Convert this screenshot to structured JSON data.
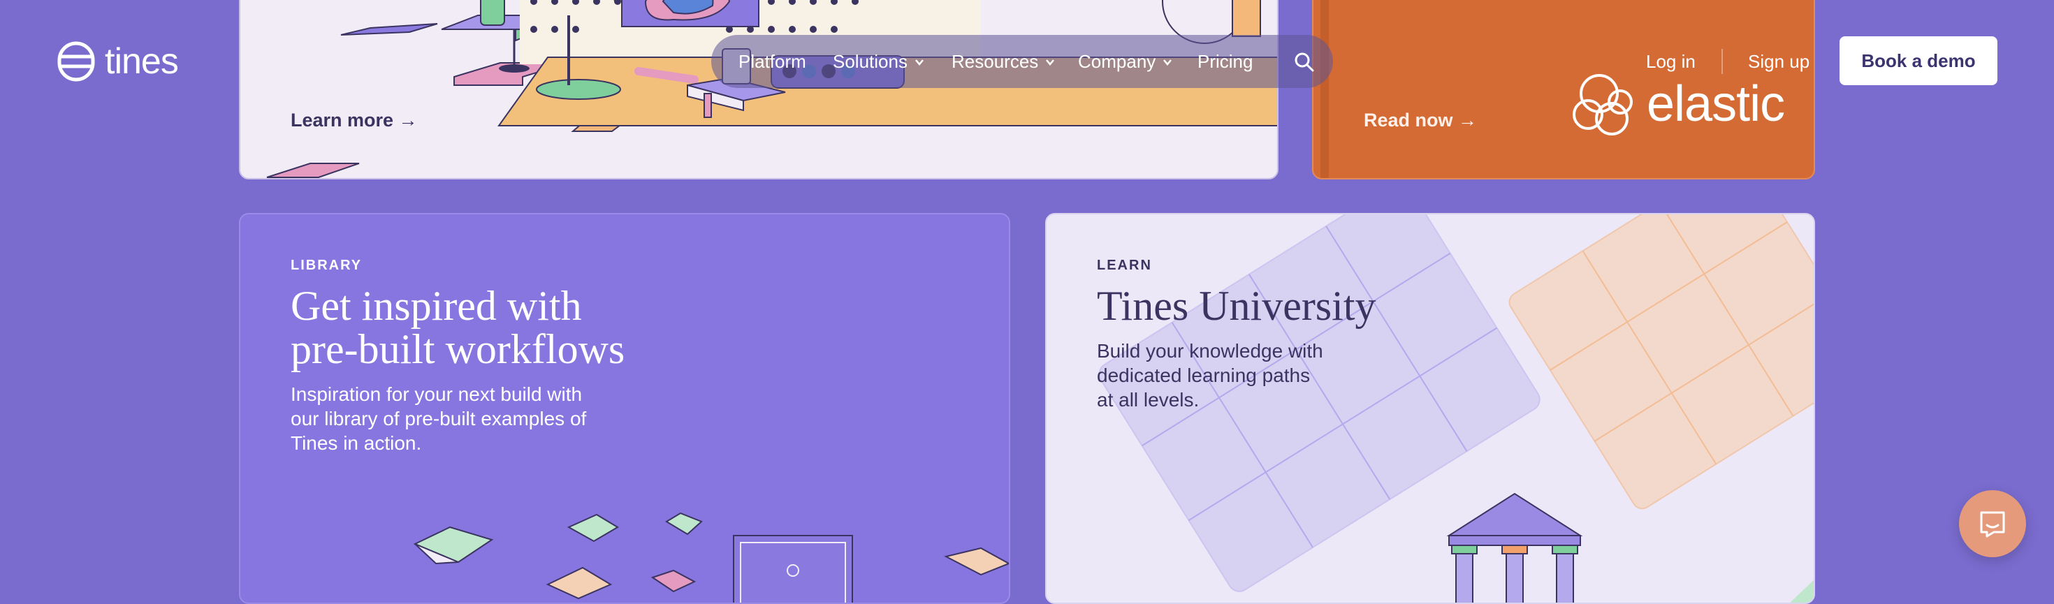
{
  "header": {
    "logo_text": "tines",
    "nav": {
      "platform": "Platform",
      "solutions": "Solutions",
      "resources": "Resources",
      "company": "Company",
      "pricing": "Pricing"
    },
    "login": "Log in",
    "signup": "Sign up",
    "book_demo": "Book a demo"
  },
  "top_cards": {
    "left_link": "Learn more →",
    "right_link": "Read now →",
    "right_logo_text": "elastic"
  },
  "library_card": {
    "eyebrow": "LIBRARY",
    "headline_line1": "Get inspired with",
    "headline_line2": "pre-built workflows",
    "body_line1": "Inspiration for your next build with",
    "body_line2": "our library of pre-built examples of",
    "body_line3": "Tines in action."
  },
  "learn_card": {
    "eyebrow": "LEARN",
    "headline": "Tines University",
    "body_line1": "Build your knowledge with",
    "body_line2": "dedicated learning paths",
    "body_line3": "at all levels."
  },
  "colors": {
    "background": "#7a6ccf",
    "library_card": "#8775e0",
    "learn_card": "#ece8f7",
    "elastic_card": "#d56b34",
    "chat_button": "#e59b7b"
  },
  "icons": [
    "tines-logo-icon",
    "chevron-down-icon",
    "search-icon",
    "elastic-logo-icon",
    "chat-icon"
  ]
}
